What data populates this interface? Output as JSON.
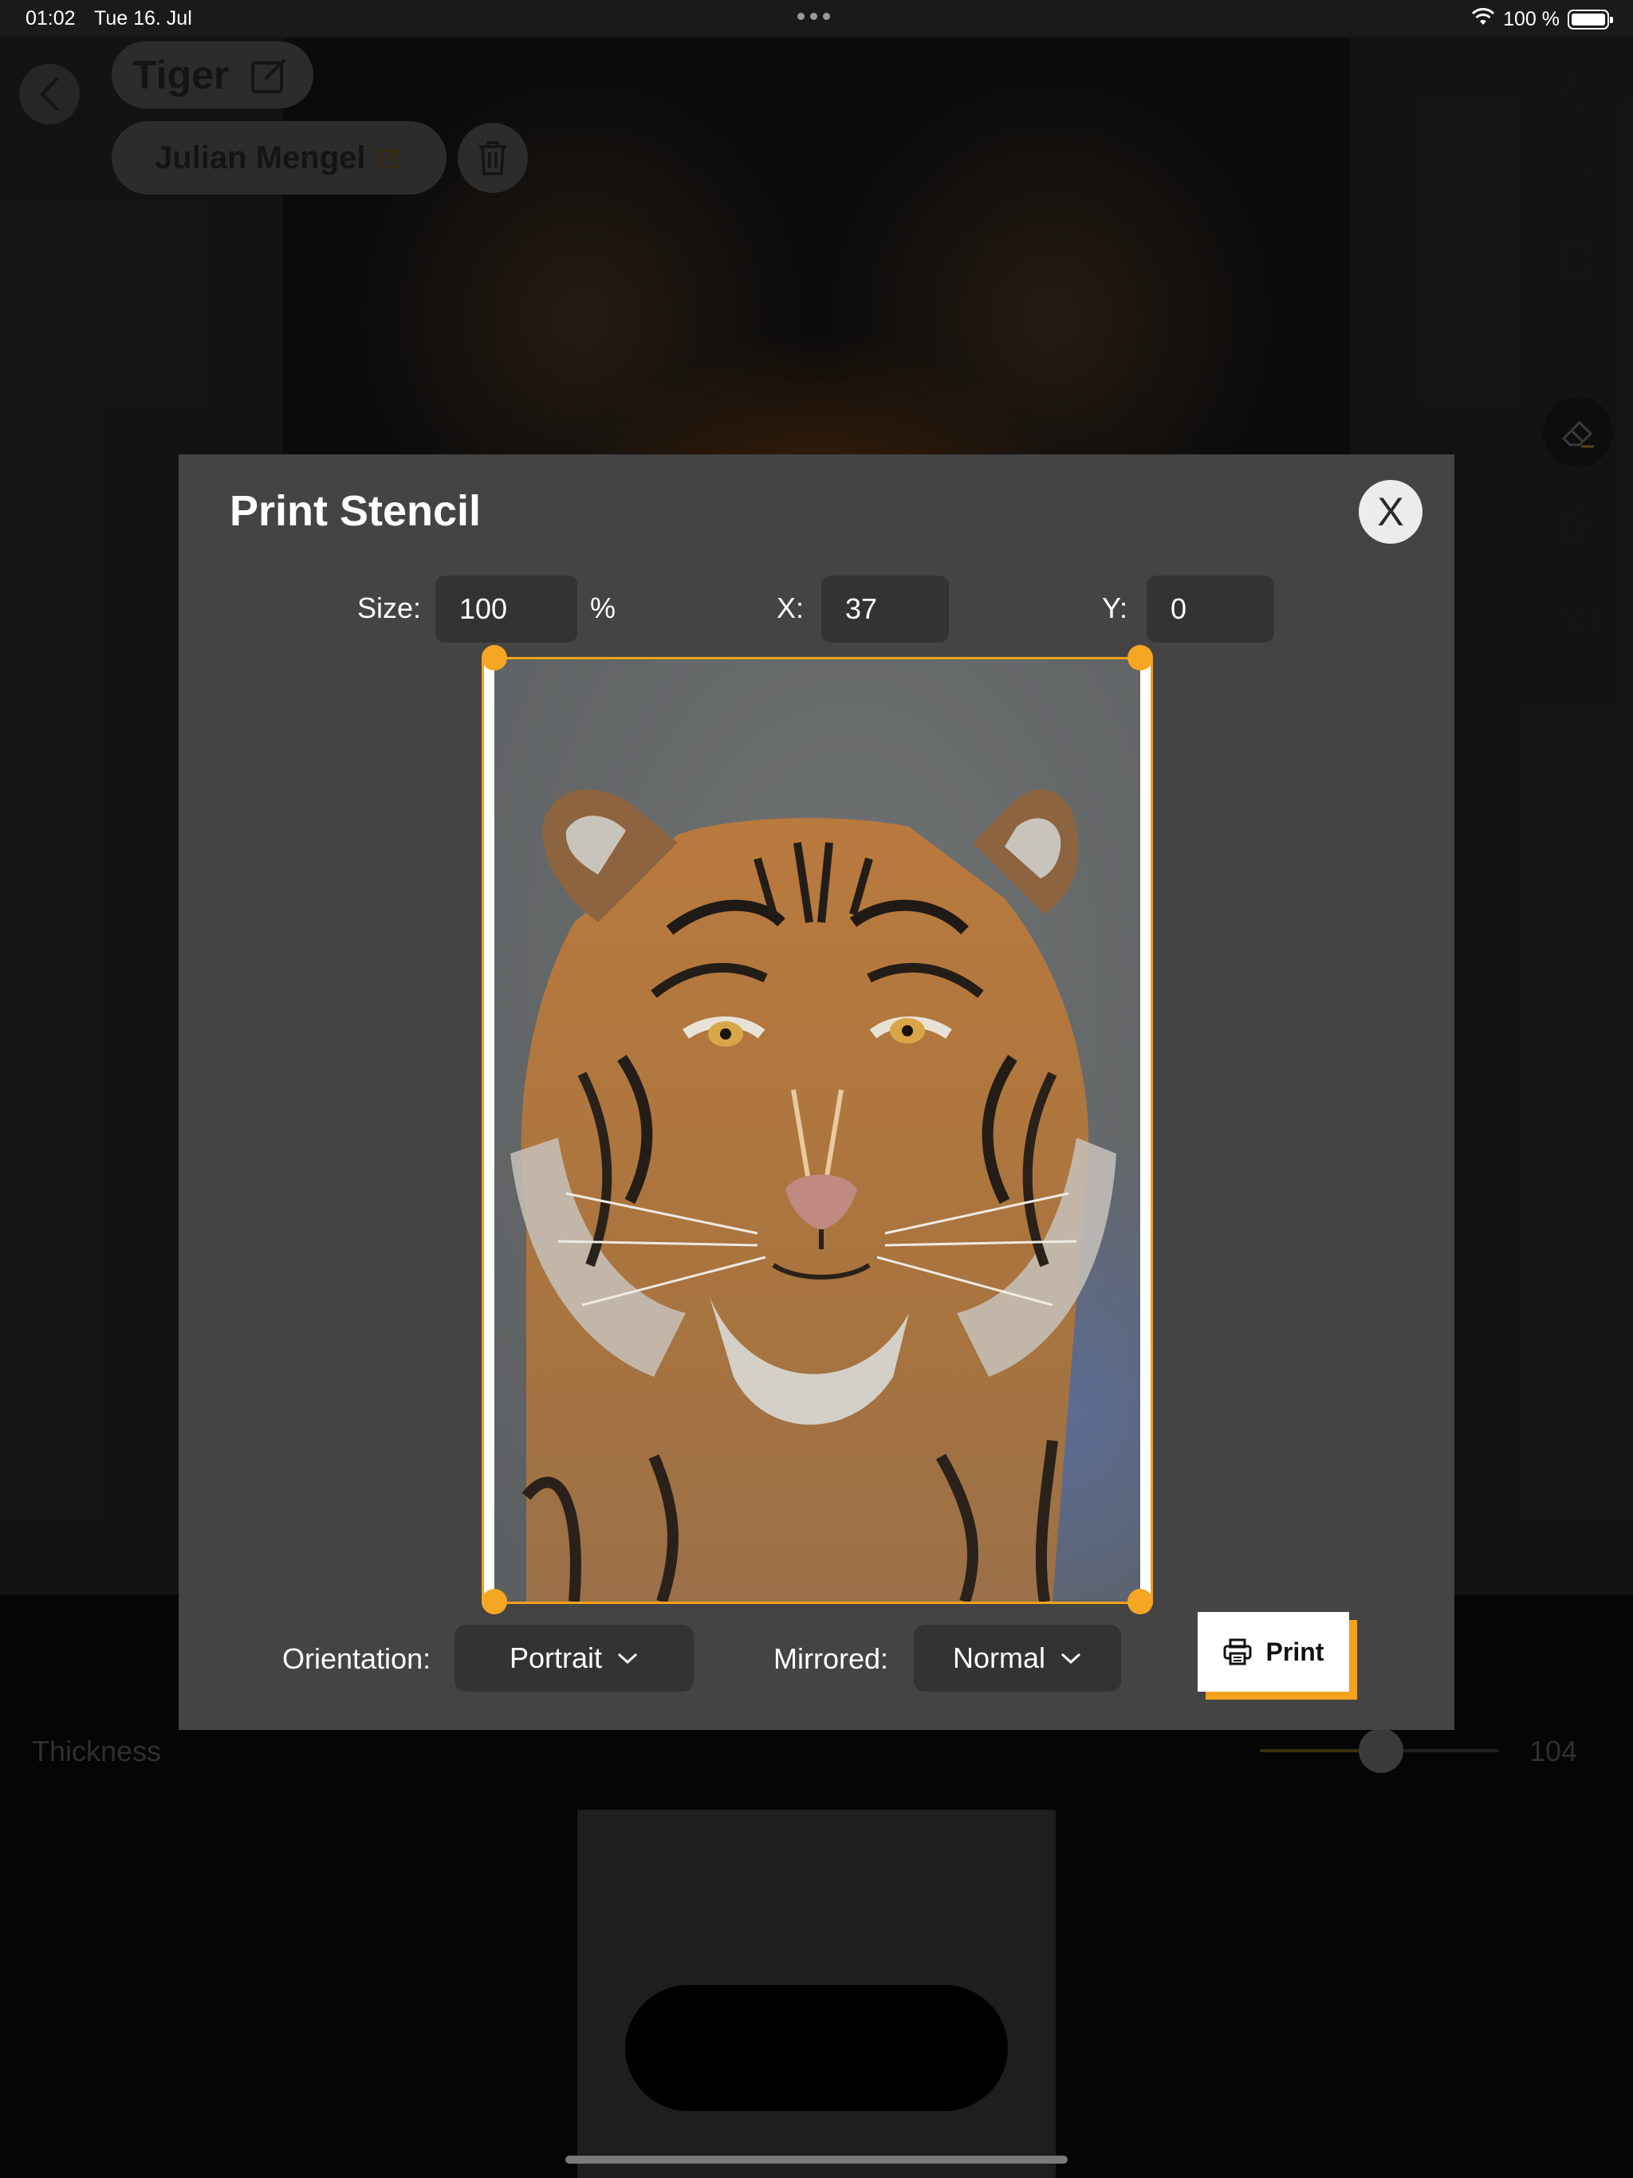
{
  "status_bar": {
    "time": "01:02",
    "date": "Tue 16. Jul",
    "battery": "100 %",
    "battery_level": 1.0
  },
  "header": {
    "title": "Tiger",
    "artist": "Julian Mengel"
  },
  "toolbar": {
    "tools": [
      "hand-icon",
      "lasso-icon",
      "resize-icon",
      "pen-icon",
      "eraser-icon",
      "rotate-right-icon",
      "rotate-left-icon"
    ],
    "active_tool": "eraser-icon"
  },
  "thickness": {
    "label": "Thickness",
    "value": "104",
    "level": 0.58
  },
  "dialog": {
    "title": "Print Stencil",
    "close_label": "X",
    "size_label": "Size:",
    "size_value": "100",
    "size_unit": "%",
    "x_label": "X:",
    "x_value": "37",
    "y_label": "Y:",
    "y_value": "0",
    "orientation_label": "Orientation:",
    "orientation_value": "Portrait",
    "mirrored_label": "Mirrored:",
    "mirrored_value": "Normal",
    "print_label": "Print"
  },
  "colors": {
    "accent": "#F5A623",
    "dialog_bg": "#444444",
    "field_bg": "#333333"
  }
}
